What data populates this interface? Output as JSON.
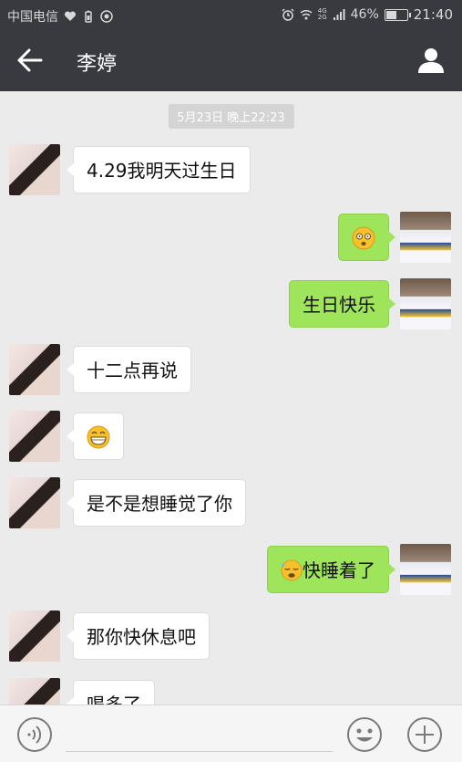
{
  "status_bar": {
    "carrier": "中国电信",
    "battery": "46%",
    "battery_level": 0.46,
    "time": "21:40",
    "network_top": "4G",
    "network_bottom": "2G"
  },
  "header": {
    "contact_name": "李婷",
    "back_icon": "arrow-left-icon",
    "profile_icon": "person-icon"
  },
  "chat": {
    "timestamp": "5月23日 晚上22:23",
    "messages": [
      {
        "from": "her",
        "text": "4.29我明天过生日"
      },
      {
        "from": "me",
        "text": "",
        "emoji": "dizzy-face-emoji"
      },
      {
        "from": "me",
        "text": "生日快乐"
      },
      {
        "from": "her",
        "text": "十二点再说"
      },
      {
        "from": "her",
        "text": "",
        "emoji": "grinning-face-emoji"
      },
      {
        "from": "her",
        "text": "是不是想睡觉了你"
      },
      {
        "from": "me",
        "text": "快睡着了",
        "emoji": "sleepy-sweat-emoji"
      },
      {
        "from": "her",
        "text": "那你快休息吧"
      },
      {
        "from": "her",
        "text": "喝多了"
      }
    ]
  },
  "input_bar": {
    "voice_icon": "voice-icon",
    "emoji_icon": "smiley-icon",
    "plus_icon": "plus-icon"
  },
  "colors": {
    "header_bg": "#393a3f",
    "chat_bg": "#ebebeb",
    "outgoing_bubble": "#9fe55b",
    "incoming_bubble": "#ffffff"
  }
}
